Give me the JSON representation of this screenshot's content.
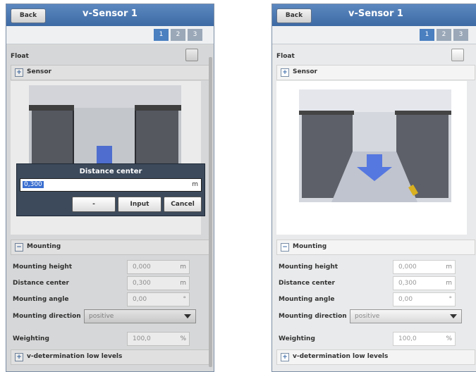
{
  "screens": [
    {
      "title": "v-Sensor 1",
      "back_label": "Back",
      "pages": [
        "1",
        "2",
        "3"
      ],
      "active_page": "1",
      "float_label": "Float",
      "sensor_label": "Sensor",
      "sensor_sign": "+",
      "mounting_label": "Mounting",
      "mounting_sign": "−",
      "fields": [
        {
          "label": "Mounting height",
          "value": "0,000",
          "unit": "m"
        },
        {
          "label": "Distance center",
          "value": "0,300",
          "unit": "m"
        },
        {
          "label": "Mounting angle",
          "value": "0,00",
          "unit": "°"
        }
      ],
      "direction_label": "Mounting direction",
      "direction_value": "positive",
      "weighting_label": "Weighting",
      "weighting_value": "100,0",
      "weighting_unit": "%",
      "low_levels_label": "v-determination low levels",
      "low_levels_sign": "+",
      "dialog": {
        "title": "Distance center",
        "value": "0,300",
        "unit": "m",
        "buttons": [
          "-",
          "Input",
          "Cancel"
        ]
      }
    },
    {
      "title": "v-Sensor 1",
      "back_label": "Back",
      "pages": [
        "1",
        "2",
        "3"
      ],
      "active_page": "1",
      "float_label": "Float",
      "sensor_label": "Sensor",
      "sensor_sign": "+",
      "mounting_label": "Mounting",
      "mounting_sign": "−",
      "fields": [
        {
          "label": "Mounting height",
          "value": "0,000",
          "unit": "m"
        },
        {
          "label": "Distance center",
          "value": "0,300",
          "unit": "m"
        },
        {
          "label": "Mounting angle",
          "value": "0,00",
          "unit": "°"
        }
      ],
      "direction_label": "Mounting direction",
      "direction_value": "positive",
      "weighting_label": "Weighting",
      "weighting_value": "100,0",
      "weighting_unit": "%",
      "low_levels_label": "v-determination low levels",
      "low_levels_sign": "+"
    }
  ],
  "colors": {
    "titlebar": "#4a78b4",
    "active_page": "#4a7fc0",
    "dialog": "#3c4a5c",
    "selection": "#3b6fd0",
    "flow_arrow": "#5577e0"
  }
}
